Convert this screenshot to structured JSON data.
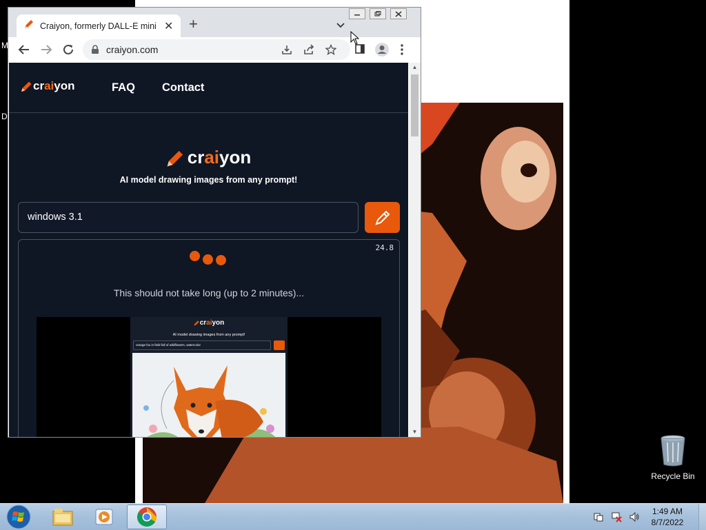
{
  "desktop": {
    "edge_labels": [
      "M",
      "D"
    ],
    "recycle_bin_label": "Recycle Bin"
  },
  "browser": {
    "tab_title": "Craiyon, formerly DALL-E mini",
    "new_tab_symbol": "+",
    "url": "craiyon.com"
  },
  "site": {
    "logo": {
      "pre": "cr",
      "ai": "ai",
      "post": "yon"
    },
    "nav": {
      "faq": "FAQ",
      "contact": "Contact"
    },
    "tagline": "AI model drawing images from any prompt!",
    "prompt_value": "windows 3.1",
    "timer": "24.8",
    "loading_message": "This should not take long (up to 2 minutes)...",
    "preview": {
      "tagline": "AI model drawing images from any prompt!",
      "prompt": "orange fox in field full of wildflowers, watercolor"
    },
    "accent_color": "#e8590c"
  },
  "taskbar": {
    "time": "1:49 AM",
    "date": "8/7/2022"
  },
  "icons": [
    "windows-start-icon",
    "file-explorer-icon",
    "media-player-icon",
    "chrome-icon",
    "pencil-icon",
    "recycle-bin-icon"
  ]
}
